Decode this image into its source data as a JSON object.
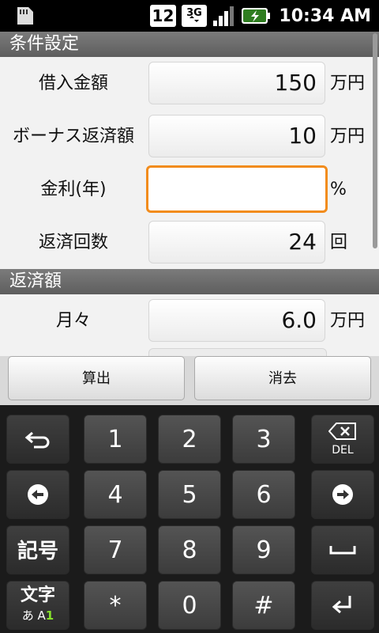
{
  "status_bar": {
    "notification_count": "12",
    "network": "3G",
    "time": "10:34 AM"
  },
  "sections": {
    "conditions": "条件設定",
    "repayment": "返済額"
  },
  "fields": {
    "loan_amount": {
      "label": "借入金額",
      "value": "150",
      "unit": "万円"
    },
    "bonus_repayment": {
      "label": "ボーナス返済額",
      "value": "10",
      "unit": "万円"
    },
    "interest_rate": {
      "label": "金利(年)",
      "value": "",
      "unit": "%"
    },
    "repayment_count": {
      "label": "返済回数",
      "value": "24",
      "unit": "回"
    },
    "monthly": {
      "label": "月々",
      "value": "6.0",
      "unit": "万円"
    }
  },
  "buttons": {
    "calculate": "算出",
    "clear": "消去"
  },
  "keyboard": {
    "digits": [
      "1",
      "2",
      "3",
      "4",
      "5",
      "6",
      "7",
      "8",
      "9",
      "*",
      "0",
      "#"
    ],
    "symbol_key": "記号",
    "mode_key_top": "文字",
    "mode_key_bottom_a": "あ A",
    "mode_key_bottom_b": "1",
    "del_key": "DEL"
  }
}
